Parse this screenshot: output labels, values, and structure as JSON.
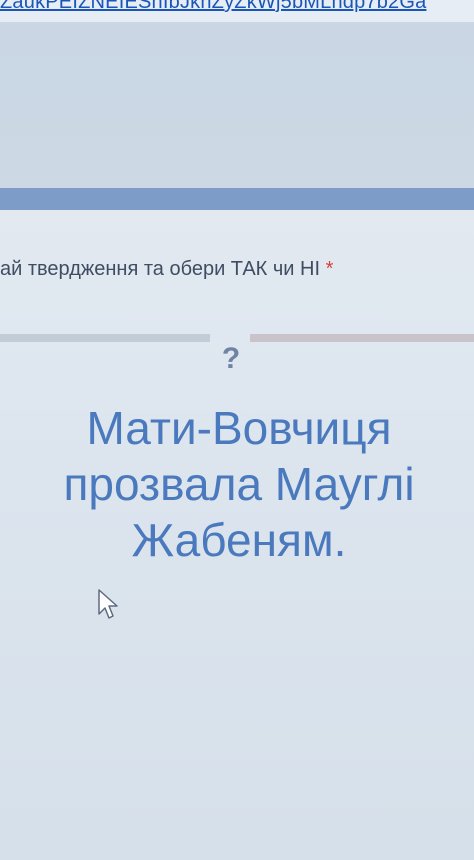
{
  "browser": {
    "url_fragment": "ZaukPEIZNEIEShIbJkhZyZkWj5bMLhdp7b2Ga"
  },
  "form": {
    "question_prompt": "ай твердження та обери ТАК чи НІ",
    "required_marker": "*",
    "question_mark": "?",
    "statement_lines": [
      "Мати-Вовчиця",
      "прозвала Мауглі",
      "Жабеням."
    ]
  },
  "colors": {
    "accent_bar": "#7d9cc7",
    "statement_text": "#4a79bd",
    "required_star": "#d9413c",
    "link": "#1a55b8"
  },
  "icons": {
    "cursor": "mouse-pointer-icon"
  }
}
